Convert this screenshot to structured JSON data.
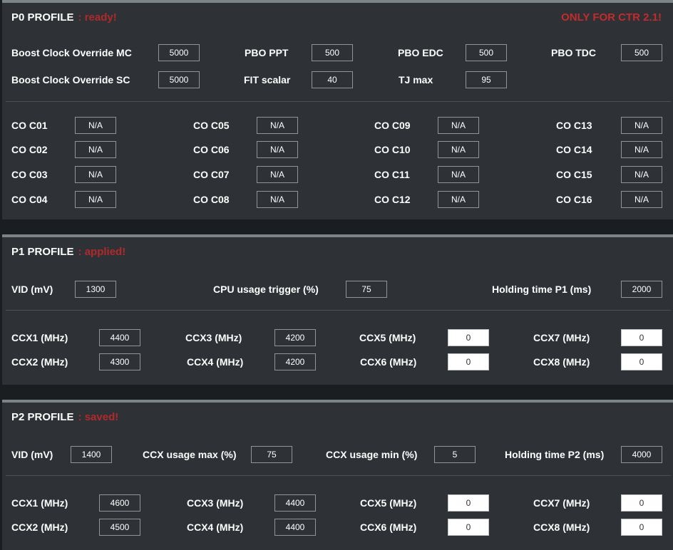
{
  "p0": {
    "title": "P0 PROFILE",
    "status": ": ready!",
    "warning": "ONLY FOR CTR 2.1!",
    "fields": [
      {
        "label": "Boost Clock Override MC",
        "value": "5000"
      },
      {
        "label": "PBO PPT",
        "value": "500"
      },
      {
        "label": "PBO EDC",
        "value": "500"
      },
      {
        "label": "PBO TDC",
        "value": "500"
      },
      {
        "label": "Boost Clock Override SC",
        "value": "5000"
      },
      {
        "label": "FIT scalar",
        "value": "40"
      },
      {
        "label": "TJ max",
        "value": "95"
      }
    ],
    "co": [
      {
        "label": "CO C01",
        "value": "N/A"
      },
      {
        "label": "CO C02",
        "value": "N/A"
      },
      {
        "label": "CO C03",
        "value": "N/A"
      },
      {
        "label": "CO C04",
        "value": "N/A"
      },
      {
        "label": "CO C05",
        "value": "N/A"
      },
      {
        "label": "CO C06",
        "value": "N/A"
      },
      {
        "label": "CO C07",
        "value": "N/A"
      },
      {
        "label": "CO C08",
        "value": "N/A"
      },
      {
        "label": "CO C09",
        "value": "N/A"
      },
      {
        "label": "CO C10",
        "value": "N/A"
      },
      {
        "label": "CO C11",
        "value": "N/A"
      },
      {
        "label": "CO C12",
        "value": "N/A"
      },
      {
        "label": "CO C13",
        "value": "N/A"
      },
      {
        "label": "CO C14",
        "value": "N/A"
      },
      {
        "label": "CO C15",
        "value": "N/A"
      },
      {
        "label": "CO C16",
        "value": "N/A"
      }
    ]
  },
  "p1": {
    "title": "P1 PROFILE",
    "status": ": applied!",
    "fields": [
      {
        "label": "VID (mV)",
        "value": "1300"
      },
      {
        "label": "CPU usage trigger (%)",
        "value": "75"
      },
      {
        "label": "Holding time P1 (ms)",
        "value": "2000"
      }
    ],
    "ccx": [
      {
        "label": "CCX1 (MHz)",
        "value": "4400"
      },
      {
        "label": "CCX2 (MHz)",
        "value": "4300"
      },
      {
        "label": "CCX3 (MHz)",
        "value": "4200"
      },
      {
        "label": "CCX4 (MHz)",
        "value": "4200"
      },
      {
        "label": "CCX5 (MHz)",
        "value": "0"
      },
      {
        "label": "CCX6 (MHz)",
        "value": "0"
      },
      {
        "label": "CCX7 (MHz)",
        "value": "0"
      },
      {
        "label": "CCX8 (MHz)",
        "value": "0"
      }
    ]
  },
  "p2": {
    "title": "P2 PROFILE",
    "status": ": saved!",
    "fields": [
      {
        "label": "VID (mV)",
        "value": "1400"
      },
      {
        "label": "CCX usage max (%)",
        "value": "75"
      },
      {
        "label": "CCX usage min (%)",
        "value": "5"
      },
      {
        "label": "Holding time P2 (ms)",
        "value": "4000"
      }
    ],
    "ccx": [
      {
        "label": "CCX1 (MHz)",
        "value": "4600"
      },
      {
        "label": "CCX2 (MHz)",
        "value": "4500"
      },
      {
        "label": "CCX3 (MHz)",
        "value": "4400"
      },
      {
        "label": "CCX4 (MHz)",
        "value": "4400"
      },
      {
        "label": "CCX5 (MHz)",
        "value": "0"
      },
      {
        "label": "CCX6 (MHz)",
        "value": "0"
      },
      {
        "label": "CCX7 (MHz)",
        "value": "0"
      },
      {
        "label": "CCX8 (MHz)",
        "value": "0"
      }
    ]
  }
}
